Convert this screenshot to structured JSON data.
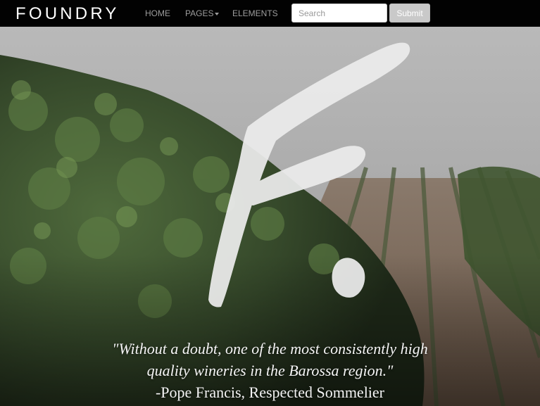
{
  "navbar": {
    "brand": "FOUNDRY",
    "links": [
      {
        "label": "HOME"
      },
      {
        "label": "PAGES"
      },
      {
        "label": "ELEMENTS"
      }
    ],
    "search": {
      "placeholder": "Search",
      "value": ""
    },
    "submit_label": "Submit"
  },
  "hero": {
    "quote": "\"Without a doubt, one of the most consistently high quality wineries in the Barossa region.\"",
    "author": "-Pope Francis, Respected Sommelier"
  },
  "colors": {
    "navbar_bg": "#020202",
    "nav_link": "#9d9d9d",
    "logo_mark": "#ececec"
  }
}
